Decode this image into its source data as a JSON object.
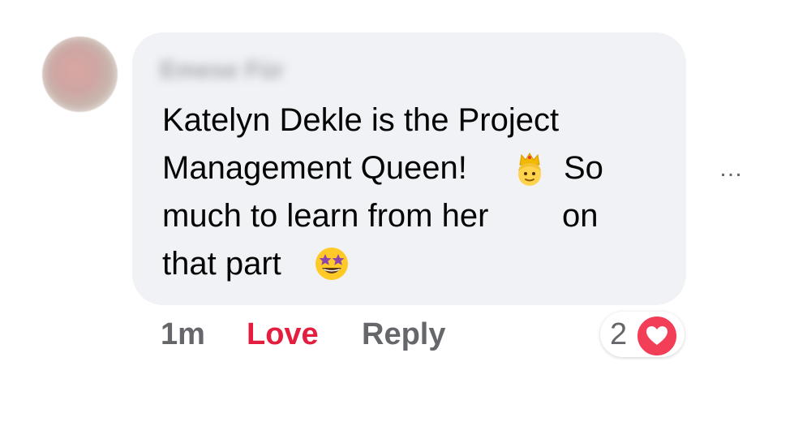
{
  "comment": {
    "author_name": "Emese Für",
    "lines": [
      "Katelyn Dekle is the Project",
      "Management Queen!",
      "So",
      "much to learn from her",
      "on",
      "that part"
    ],
    "emojis": [
      "prince-emoji",
      "star-struck-emoji"
    ]
  },
  "actions": {
    "time": "1m",
    "love_label": "Love",
    "reply_label": "Reply",
    "more_icon": "…"
  },
  "reactions": {
    "count": "2",
    "icon": "heart-icon",
    "color": "#f33e58"
  },
  "colors": {
    "bubble": "#f0f2f5",
    "love": "#e41e3f",
    "muted": "#65676b"
  }
}
